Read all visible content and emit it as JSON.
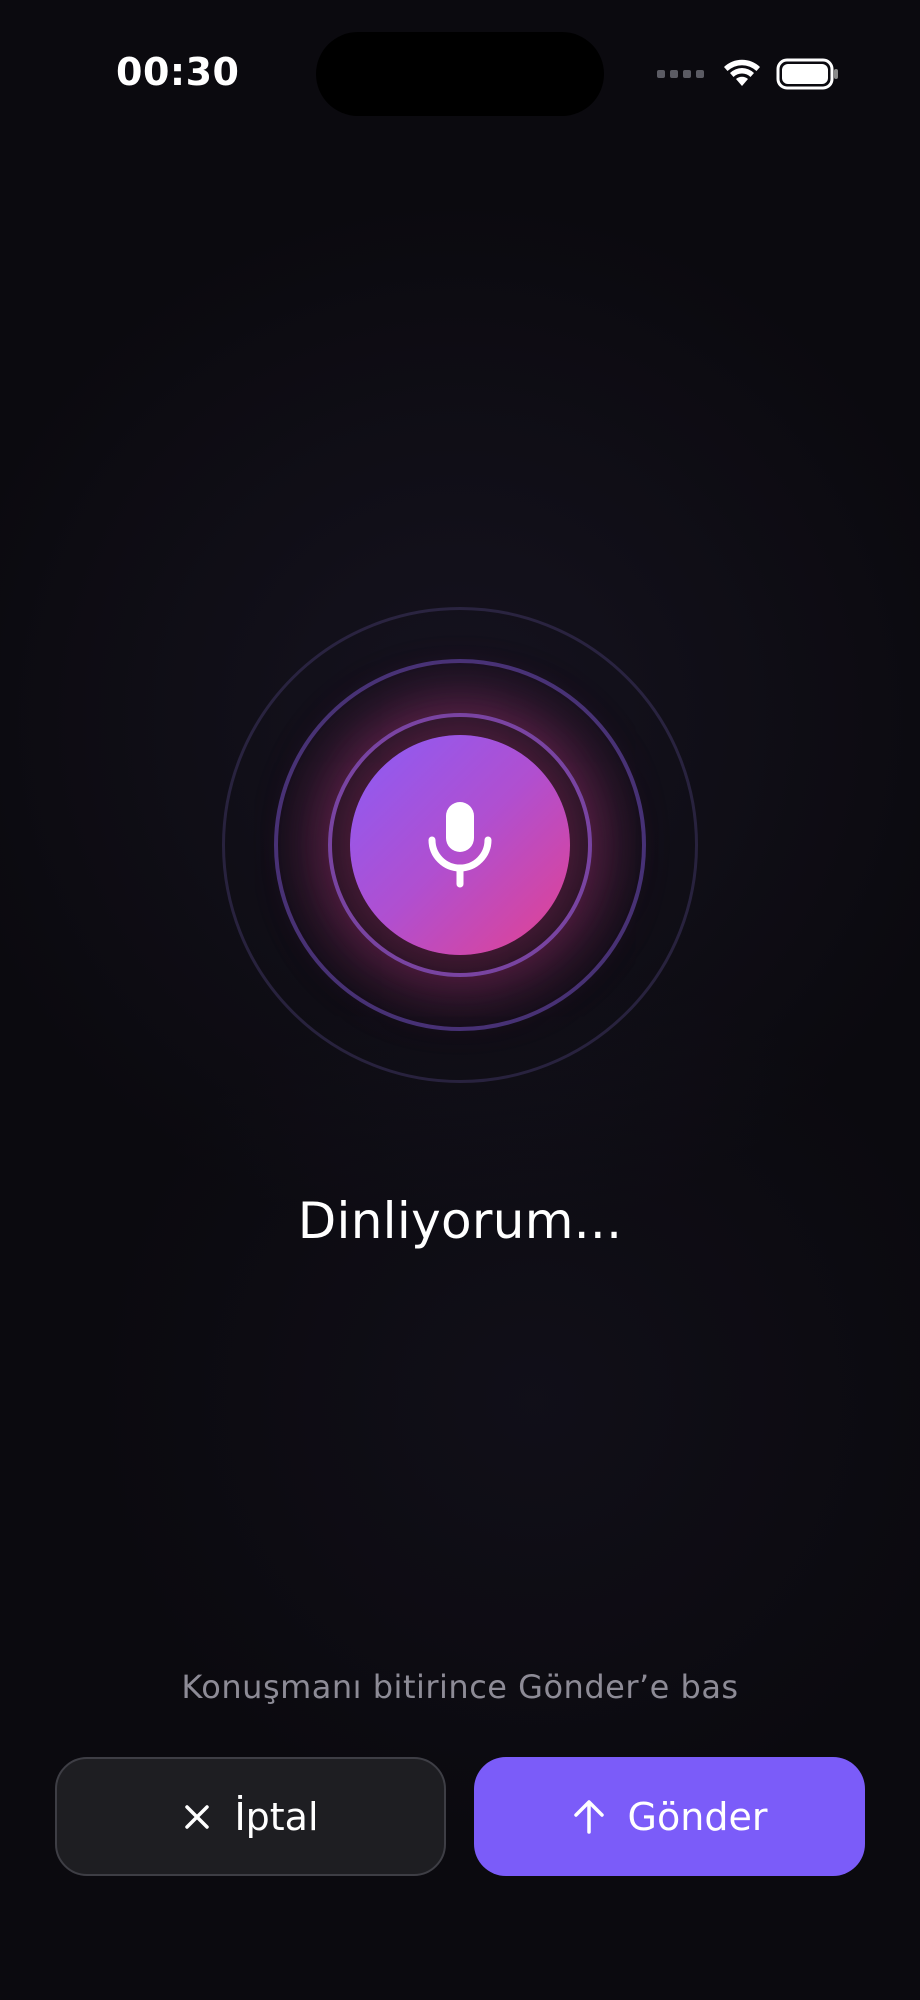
{
  "status_bar": {
    "time": "00:30"
  },
  "mic": {
    "icon": "microphone-icon",
    "gradient_start": "#8b5cf6",
    "gradient_end": "#e4418f"
  },
  "listening": {
    "title": "Dinliyorum..."
  },
  "hint": {
    "text": "Konuşmanı bitirince Gönder’e bas"
  },
  "actions": {
    "cancel_label": "İptal",
    "cancel_icon": "close-icon",
    "send_label": "Gönder",
    "send_icon": "arrow-up-icon"
  },
  "colors": {
    "background": "#0b0a0f",
    "accent": "#7b5cf9",
    "cancel_bg": "#1e1e22",
    "hint": "#8d8b96"
  }
}
